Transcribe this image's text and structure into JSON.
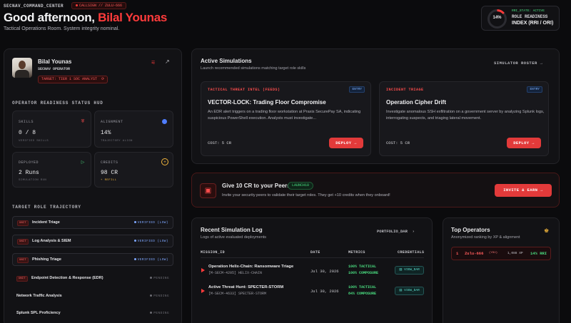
{
  "header": {
    "brand": "SECNAV_COMMAND_CENTER",
    "callsign": "CALLSIGN // ZULU-666",
    "greeting_prefix": "Good afternoon,",
    "greeting_name": "Bilal Younas",
    "subtitle": "Tactical Operations Room. System integrity nominal.",
    "rri": {
      "percent": "14%",
      "value": 0.14,
      "state": "RRI_STATE: ACTIVE",
      "line1": "ROLE READINESS",
      "line2": "INDEX (RRI / ORI)"
    }
  },
  "profile": {
    "name": "Bilal Younas",
    "role": "SECNAV OPERATOR",
    "target": "TARGET: TIER 1 SOC ANALYST"
  },
  "hud": {
    "title": "OPERATOR READINESS STATUS HUD",
    "stats": [
      {
        "label": "SKILLS",
        "value": "0 / 8",
        "sub": "VERIFIED SKILLS",
        "icon": "shield-icon",
        "color": "#ff4d4d"
      },
      {
        "label": "ALIGNMENT",
        "value": "14%",
        "sub": "TRAJECTORY ALIGN",
        "icon": "globe-icon",
        "color": "#4f7dff"
      },
      {
        "label": "DEPLOYED",
        "value": "2 Runs",
        "sub": "SIMULATION RUN",
        "icon": "play-icon",
        "color": "#4ade80"
      },
      {
        "label": "CREDITS",
        "value": "98 CR",
        "sub": "+ REFILL",
        "icon": "plus-icon",
        "color": "#f5b83d"
      }
    ]
  },
  "trajectory": {
    "title": "TARGET ROLE TRAJECTORY",
    "items": [
      {
        "tag": "UNIT",
        "name": "Incident Triage",
        "status": "VERIFIED (LOW)",
        "state": "verified"
      },
      {
        "tag": "UNIT",
        "name": "Log Analysis & SIEM",
        "status": "VERIFIED (LOW)",
        "state": "verified"
      },
      {
        "tag": "UNIT",
        "name": "Phishing Triage",
        "status": "VERIFIED (LOW)",
        "state": "verified"
      },
      {
        "tag": "UNIT",
        "name": "Endpoint Detection & Response (EDR)",
        "status": "PENDING",
        "state": "pending"
      },
      {
        "tag": "",
        "name": "Network Traffic Analysis",
        "status": "PENDING",
        "state": "pending"
      },
      {
        "tag": "",
        "name": "Splunk SPL Proficiency",
        "status": "PENDING",
        "state": "pending"
      }
    ]
  },
  "simulations": {
    "title": "Active Simulations",
    "subtitle": "Launch recommended simulations matching target role skills",
    "roster_label": "SIMULATOR ROSTER",
    "cards": [
      {
        "category": "TACTICAL THREAT INTEL (FEEDS)",
        "badge": "ENTRY",
        "title": "VECTOR-LOCK: Trading Floor Compromise",
        "desc": "An EDR alert triggers on a trading floor workstation at Praxis SecurePay SA, indicating suspicious PowerShell execution. Analysts must investigate...",
        "cost": "COST: 5 CR",
        "deploy": "DEPLOY"
      },
      {
        "category": "INCIDENT TRIAGE",
        "badge": "ENTRY",
        "title": "Operation Cipher Drift",
        "desc": "Investigate anomalous SSH exfiltration on a government server by analyzing Splunk logs, interrogating suspects, and triaging lateral movement.",
        "cost": "COST: 5 CR",
        "deploy": "DEPLOY"
      }
    ]
  },
  "referral": {
    "title": "Give 10 CR to your Peers",
    "code": "LAUNCH10",
    "desc": "Invite your security peers to validate their target roles. They get +10 credits when they onboard!",
    "button": "INVITE & EARN"
  },
  "log": {
    "title": "Recent Simulation Log",
    "subtitle": "Logs of active evaluated deployments",
    "portfolio": "PORTFOLIO_DAR",
    "columns": [
      "MISSION_ID",
      "DATE",
      "METRICS",
      "CREDENTIALS"
    ],
    "rows": [
      {
        "name": "Operation Helix-Chain: Ransomware Triage",
        "id": "[M-SECM-4205] HELIX-CHAIN",
        "date": "Jul 30, 2026",
        "m1": "100% TACTICAL",
        "m2": "100% COMPOSURE",
        "cred": "VIEW_DAR"
      },
      {
        "name": "Active Threat Hunt: SPECTER-STORM",
        "id": "[M-SECM-4633] SPECTER-STORM",
        "date": "Jul 30, 2026",
        "m1": "100% TACTICAL",
        "m2": "84% COMPOSURE",
        "cred": "VIEW_DAR"
      }
    ]
  },
  "top_operators": {
    "title": "Top Operators",
    "subtitle": "Anonymized ranking by XP & alignment",
    "entries": [
      {
        "rank": "1",
        "name": "Zulu-666",
        "you": "(YOU)",
        "xp": "1,088 XP",
        "rri": "14% RRI"
      }
    ]
  },
  "colors": {
    "accent": "#ff3b3b",
    "bg": "#0b0b0d",
    "panel": "#121215"
  }
}
